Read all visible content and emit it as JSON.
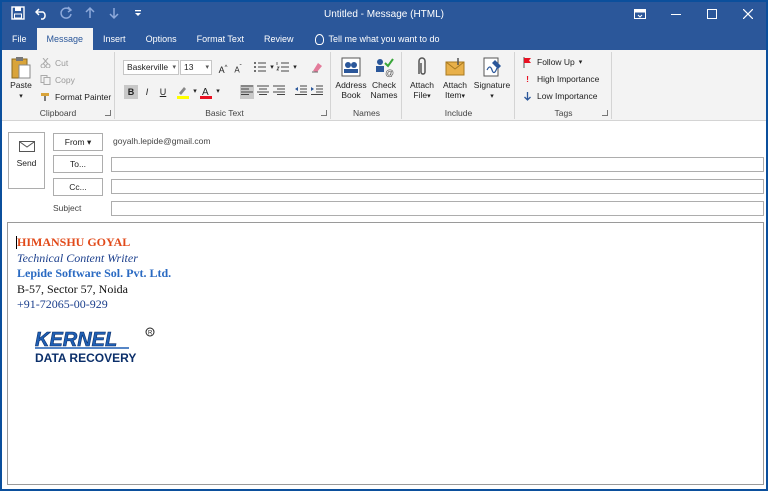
{
  "window": {
    "title": "Untitled  -  Message (HTML)",
    "accent": "#2b579a"
  },
  "tabs": [
    {
      "label": "File"
    },
    {
      "label": "Message",
      "active": true
    },
    {
      "label": "Insert"
    },
    {
      "label": "Options"
    },
    {
      "label": "Format Text"
    },
    {
      "label": "Review"
    }
  ],
  "tell_me": "Tell me what you want to do",
  "ribbon": {
    "clipboard": {
      "paste": "Paste",
      "cut": "Cut",
      "copy": "Copy",
      "format_painter": "Format Painter",
      "label": "Clipboard"
    },
    "basic_text": {
      "font": "Baskerville",
      "size": "13",
      "label": "Basic Text"
    },
    "names": {
      "address_book": [
        "Address",
        "Book"
      ],
      "check_names": [
        "Check",
        "Names"
      ],
      "label": "Names"
    },
    "include": {
      "attach_file": [
        "Attach",
        "File"
      ],
      "attach_item": [
        "Attach",
        "Item"
      ],
      "signature": [
        "Signature",
        ""
      ],
      "label": "Include"
    },
    "tags": {
      "follow_up": "Follow Up",
      "high_importance": "High Importance",
      "low_importance": "Low Importance",
      "label": "Tags"
    }
  },
  "message": {
    "send": "Send",
    "from_label": "From",
    "from_value": "goyalh.lepide@gmail.com",
    "to_label": "To...",
    "cc_label": "Cc...",
    "subject_label": "Subject"
  },
  "signature": {
    "name": "HIMANSHU GOYAL",
    "role": "Technical Content Writer",
    "company": "Lepide Software Sol. Pvt. Ltd.",
    "address": "B-57, Sector 57, Noida",
    "phone": "+91-72065-00-929",
    "logo_top": "KERNEL",
    "logo_bottom": "DATA RECOVERY"
  }
}
